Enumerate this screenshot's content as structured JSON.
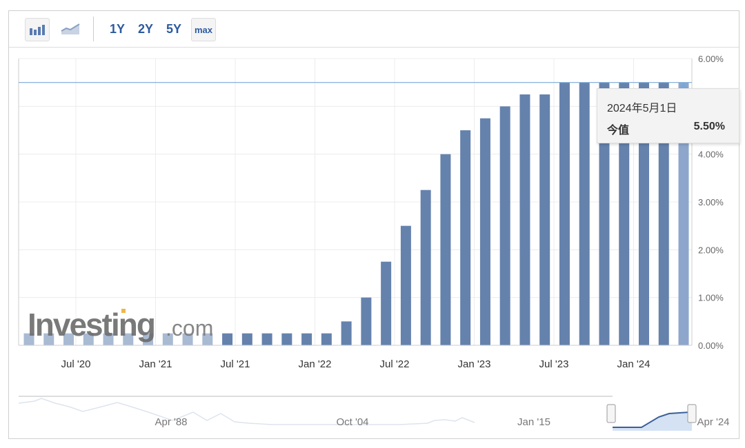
{
  "toolbar": {
    "buttons": [
      "1Y",
      "2Y",
      "5Y",
      "max"
    ],
    "icons": [
      "bar-chart-icon",
      "area-chart-icon"
    ]
  },
  "watermark": {
    "brand": "Investing",
    "suffix": ".com"
  },
  "tooltip": {
    "date": "2024年5月1日",
    "label": "今值",
    "value": "5.50%"
  },
  "navigator": {
    "labels": [
      "Apr '88",
      "Oct '04",
      "Jan '15",
      "Apr '24"
    ]
  },
  "colors": {
    "bar": "#6582ad",
    "bar_faded": "#a9bad3",
    "crosshair": "#7aa7d6"
  },
  "chart_data": {
    "type": "bar",
    "title": "",
    "xlabel": "",
    "ylabel": "",
    "ylim": [
      0,
      6
    ],
    "yticks": [
      "0.00%",
      "1.00%",
      "2.00%",
      "3.00%",
      "4.00%",
      "5.00%",
      "6.00%"
    ],
    "xticks": [
      "Jul '20",
      "Jan '21",
      "Jul '21",
      "Jan '22",
      "Jul '22",
      "Jan '23",
      "Jul '23",
      "Jan '24"
    ],
    "values": [
      0.25,
      0.25,
      0.25,
      0.25,
      0.25,
      0.25,
      0.25,
      0.25,
      0.25,
      0.25,
      0.25,
      0.25,
      0.25,
      0.25,
      0.25,
      0.25,
      0.5,
      1.0,
      1.75,
      2.5,
      3.25,
      4.0,
      4.5,
      4.75,
      5.0,
      5.25,
      5.25,
      5.5,
      5.5,
      5.5,
      5.5,
      5.5,
      5.5,
      5.5
    ],
    "highlight_value": 5.5,
    "grid": true
  }
}
